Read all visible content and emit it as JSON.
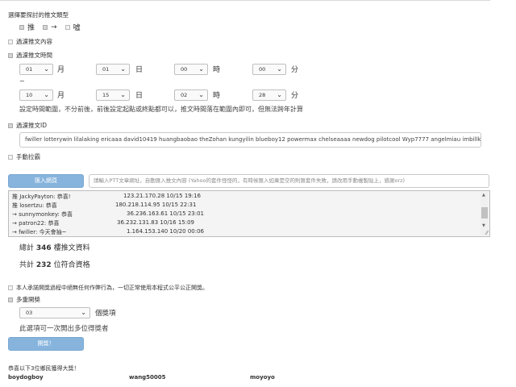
{
  "post_type": {
    "heading": "選擇要探討的推文類型",
    "options": [
      {
        "label": "推",
        "checked": true
      },
      {
        "label": "→",
        "checked": true
      },
      {
        "label": "噓",
        "checked": false
      }
    ]
  },
  "filter_content": {
    "label": "過濾推文內容",
    "checked": false
  },
  "filter_time": {
    "label": "過濾推文時間",
    "checked": true,
    "start": {
      "month": "01",
      "day": "01",
      "hour": "00",
      "minute": "00"
    },
    "end": {
      "month": "10",
      "day": "15",
      "hour": "02",
      "minute": "28"
    },
    "units": {
      "month": "月",
      "day": "日",
      "hour": "時",
      "minute": "分"
    },
    "tilde": "~",
    "note": "設定時間範圍，不分前後，前後設定起點或終點都可以，推文時間落在範圍內即可，但無法跨年計算"
  },
  "filter_id": {
    "label": "過濾推文ID",
    "checked": true,
    "value": "fwiller  lotterywin  lilalaking ericaaa david10419  huangbaobao theZohan kungyilin blueboy12 powermax chelseaaaa newdog pilotcool Wyp7777 angelmiau imbillking clonea"
  },
  "manual_lottery": {
    "label": "手動拉霸",
    "checked": false
  },
  "import": {
    "button_label": "匯入網頁",
    "placeholder": "請輸入PTT文章網址，自動匯入推文內容 (Yahoo的套件怪怪的，有時候匯入如果是空的則匯套件失敗，請改用手動複製貼上，感謝orz)"
  },
  "comments": [
    {
      "text": "推 JackyPayton: 恭喜!",
      "meta": "123.21.170.28 10/15 19:16"
    },
    {
      "text": "推 losertzu: 恭喜",
      "meta": "180.218.114.95 10/15 22:31"
    },
    {
      "text": "→ sunnymonkey: 恭喜",
      "meta": "36.236.163.61 10/15 23:01"
    },
    {
      "text": "→ patron22: 恭喜",
      "meta": "36.232.131.83 10/16 15:09"
    },
    {
      "text": "→ fwiller: 今天會抽~",
      "meta": "1.164.153.140 10/20 00:06"
    }
  ],
  "stats": {
    "total_prefix": "總計",
    "total_count": "346",
    "total_suffix": "樓推文資料",
    "qualified_prefix": "共計",
    "qualified_count": "232",
    "qualified_suffix": "位符合資格"
  },
  "disclaimer": {
    "label": "本人承諾開獎過程中絕無任何作弊行為，一切正常使用本程式公平公正開獎。",
    "checked": false
  },
  "multi_prize": {
    "label": "多重開獎",
    "checked": true,
    "value": "03",
    "unit": "個獎項",
    "note": "此選項可一次開出多位得獎者"
  },
  "draw_button": "開獎！",
  "winners_heading": "恭喜以下3位鄉民獲得大獎！",
  "winners": [
    "boydogboy",
    "wang50005",
    "moyoyo"
  ]
}
